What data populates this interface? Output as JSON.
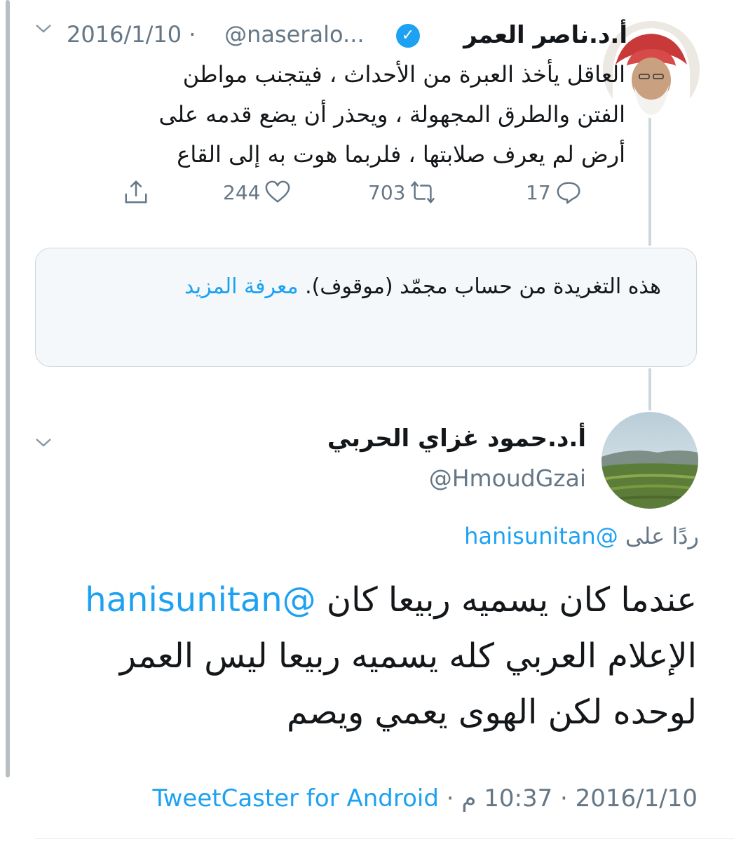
{
  "tweet1": {
    "name": "أ.د.ناصر العمر",
    "handle": "@naseralo...",
    "date": "2016/1/10",
    "separator": "·",
    "body_lines": [
      "العاقل يأخذ العبرة من الأحداث ، فيتجنب مواطن",
      "الفتن والطرق المجهولة ، ويحذر أن يضع قدمه على",
      "أرض لم يعرف صلابتها ، فلربما هوت به إلى القاع"
    ],
    "replies": "17",
    "retweets": "703",
    "likes": "244"
  },
  "notice": {
    "text": "هذه التغريدة من حساب مجمّد (موقوف).",
    "link": "معرفة المزيد"
  },
  "tweet2": {
    "name": "أ.د.حمود غزاي الحربي",
    "handle": "@HmoudGzai",
    "reply_prefix": "ردًا على",
    "reply_handle": "@hanisunitan",
    "body_mention": "@hanisunitan",
    "body_line1": "عندما كان يسميه ربيعا كان",
    "body_line2": "الإعلام العربي كله يسميه ربيعا ليس العمر",
    "body_line3": "لوحده لكن الهوى يعمي ويصم",
    "date": "2016/1/10",
    "time": "10:37 م",
    "source": "TweetCaster for Android",
    "separator": "·"
  },
  "colors": {
    "link": "#1da1f2",
    "secondary_text": "#657786",
    "border": "#ccd6dd"
  },
  "icons": [
    "chevron-down-icon",
    "verified-badge-icon",
    "reply-icon",
    "retweet-icon",
    "like-icon",
    "share-icon"
  ]
}
